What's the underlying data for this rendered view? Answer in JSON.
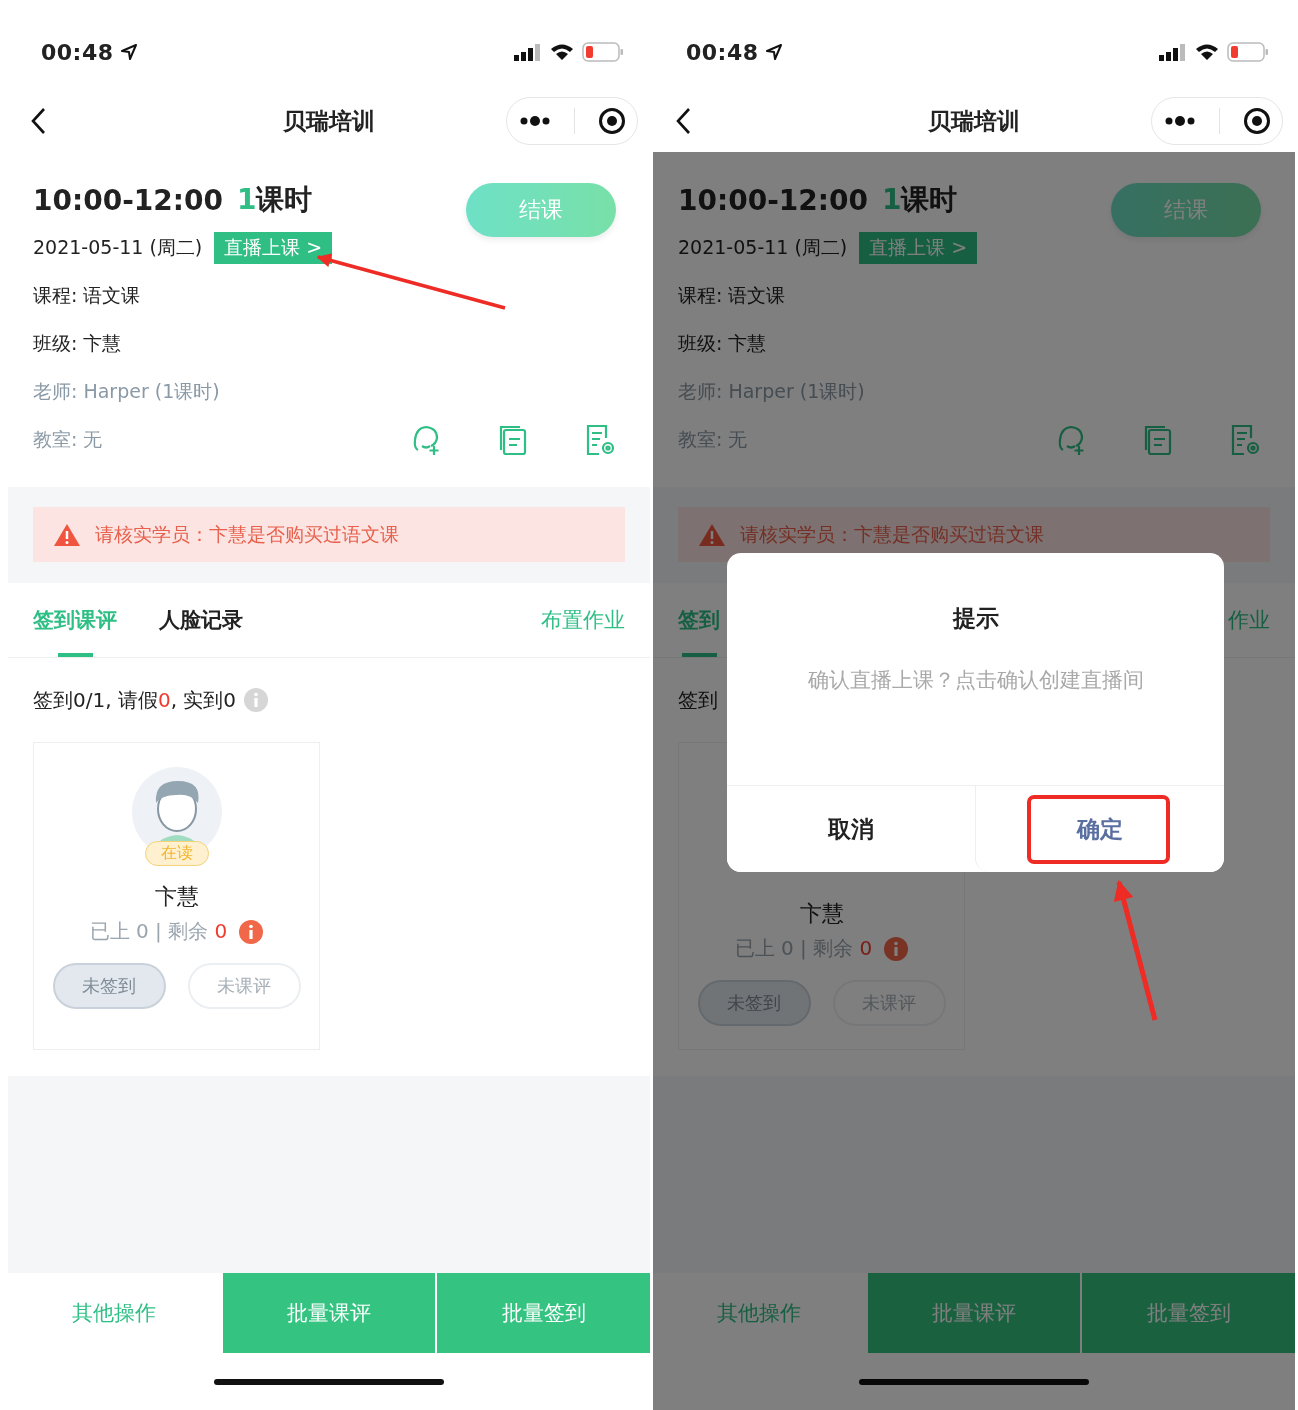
{
  "screens": [
    {
      "status": {
        "time": "00:48"
      },
      "nav": {
        "title": "贝瑞培训"
      },
      "lesson": {
        "time_range": "10:00-12:00",
        "hours_count": "1",
        "hours_unit": "课时",
        "end_button": "结课",
        "date": "2021-05-11 (周二)",
        "live_button": "直播上课 >",
        "course": "课程: 语文课",
        "class": "班级: 卞慧",
        "teacher": "老师: Harper (1课时)",
        "room": "教室: 无"
      },
      "warning": "请核实学员：卞慧是否购买过语文课",
      "tabs": [
        {
          "label": "签到课评",
          "selected": true
        },
        {
          "label": "人脸记录",
          "selected": false
        }
      ],
      "homework_link": "布置作业",
      "summary": {
        "prefix": "签到0/1, 请假",
        "leave": "0",
        "suffix": ", 实到0"
      },
      "student": {
        "avatar": true,
        "status": "在读",
        "name": "卞慧",
        "attended": "已上 0",
        "separator": "|",
        "remaining_label": "剩余",
        "remaining": "0",
        "buttons": [
          {
            "label": "未签到",
            "disabled": false
          },
          {
            "label": "未课评",
            "disabled": true
          }
        ]
      },
      "actions": [
        {
          "label": "其他操作",
          "kind": "secondary"
        },
        {
          "label": "批量课评",
          "kind": "primary"
        },
        {
          "label": "批量签到",
          "kind": "primary"
        }
      ]
    },
    {
      "status": {
        "time": "00:48"
      },
      "nav": {
        "title": "贝瑞培训"
      },
      "lesson": {
        "time_range": "10:00-12:00",
        "hours_count": "1",
        "hours_unit": "课时",
        "end_button": "结课",
        "date": "2021-05-11 (周二)",
        "live_button": "直播上课 >",
        "course": "课程: 语文课",
        "class": "班级: 卞慧",
        "teacher": "老师: Harper (1课时)",
        "room": "教室: 无"
      },
      "warning": "请核实学员：卞慧是否购买过语文课",
      "tabs": [
        {
          "label": "签到",
          "selected": true
        }
      ],
      "homework_link": "作业",
      "summary": {
        "prefix": "签到"
      },
      "student": {
        "name": "卞慧",
        "attended": "已上 0",
        "separator": "|",
        "remaining_label": "剩余",
        "remaining": "0",
        "buttons": [
          {
            "label": "未签到",
            "disabled": false
          },
          {
            "label": "未课评",
            "disabled": true
          }
        ]
      },
      "actions": [
        {
          "label": "其他操作",
          "kind": "secondary"
        },
        {
          "label": "批量课评",
          "kind": "primary"
        },
        {
          "label": "批量签到",
          "kind": "primary"
        }
      ],
      "dialog": {
        "title": "提示",
        "message": "确认直播上课？点击确认创建直播间",
        "buttons": [
          {
            "label": "取消",
            "kind": "cancel"
          },
          {
            "label": "确定",
            "kind": "confirm"
          }
        ]
      }
    }
  ]
}
